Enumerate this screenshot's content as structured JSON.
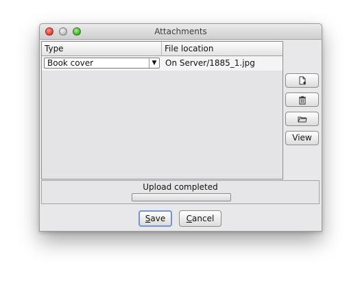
{
  "window": {
    "title": "Attachments"
  },
  "table": {
    "columns": [
      "Type",
      "File location"
    ],
    "rows": [
      {
        "type": "Book cover",
        "location": "On Server/1885_1.jpg"
      }
    ]
  },
  "side_buttons": {
    "add_icon": "new-document-icon",
    "delete_icon": "trash-icon",
    "open_icon": "folder-icon",
    "view_label": "View"
  },
  "status": {
    "text": "Upload completed",
    "progress": 0
  },
  "buttons": {
    "save": "Save",
    "cancel": "Cancel"
  },
  "colors": {
    "close": "#e0382c",
    "minimize": "#b9b9b9",
    "maximize": "#3fae26",
    "default_button_border": "#6f93d8"
  }
}
